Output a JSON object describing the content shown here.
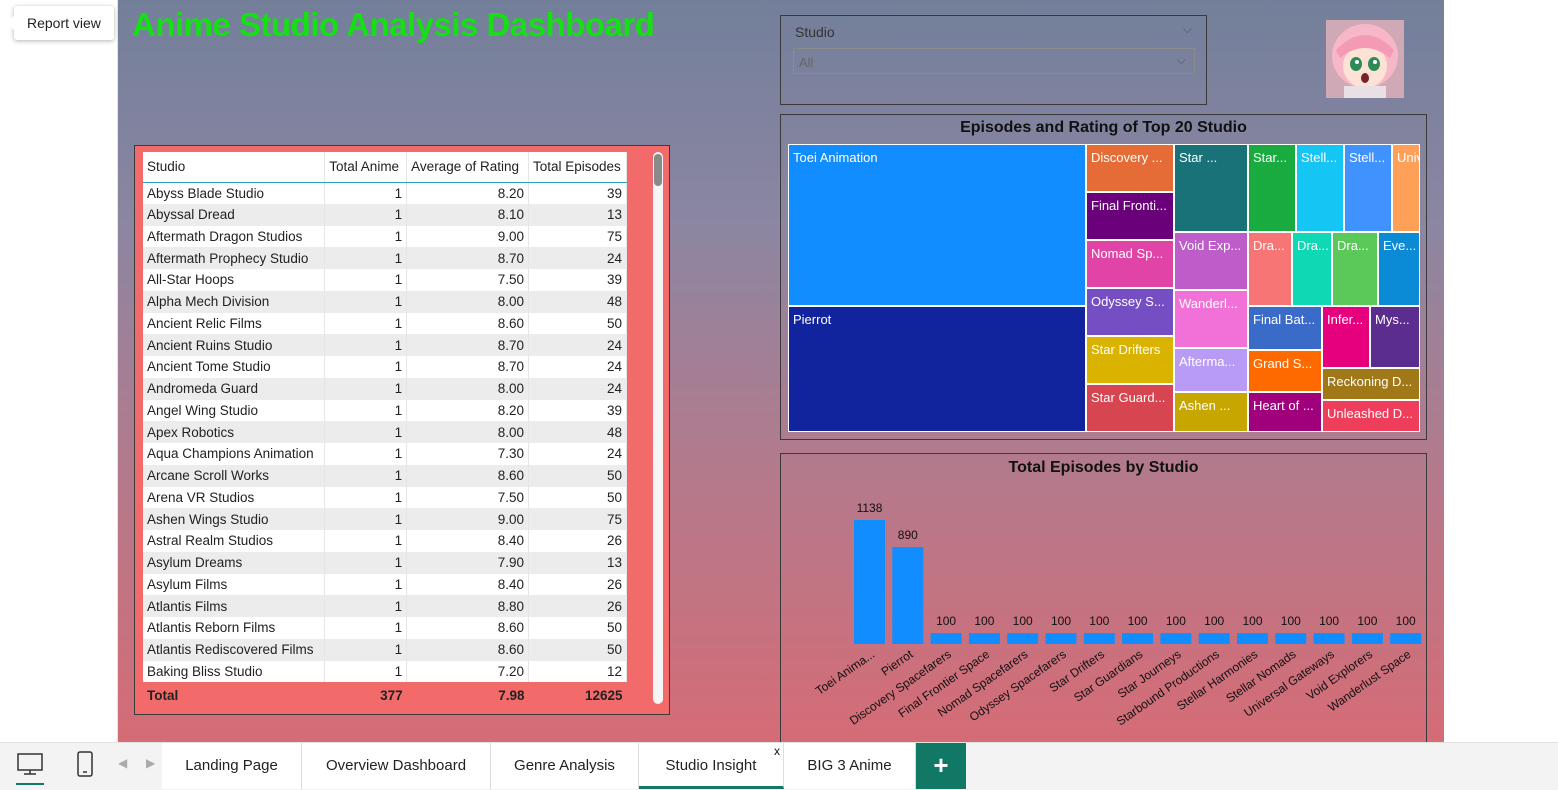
{
  "tooltip": {
    "report_view": "Report view"
  },
  "dashboard": {
    "title": "Anime Studio Analysis Dashboard"
  },
  "slicer": {
    "title": "Studio",
    "placeholder": "All"
  },
  "table": {
    "columns": [
      "Studio",
      "Total Anime",
      "Average of Rating",
      "Total Episodes"
    ],
    "rows": [
      [
        "Abyss Blade Studio",
        "1",
        "8.20",
        "39"
      ],
      [
        "Abyssal Dread",
        "1",
        "8.10",
        "13"
      ],
      [
        "Aftermath Dragon Studios",
        "1",
        "9.00",
        "75"
      ],
      [
        "Aftermath Prophecy Studio",
        "1",
        "8.70",
        "24"
      ],
      [
        "All-Star Hoops",
        "1",
        "7.50",
        "39"
      ],
      [
        "Alpha Mech Division",
        "1",
        "8.00",
        "48"
      ],
      [
        "Ancient Relic Films",
        "1",
        "8.60",
        "50"
      ],
      [
        "Ancient Ruins Studio",
        "1",
        "8.70",
        "24"
      ],
      [
        "Ancient Tome Studio",
        "1",
        "8.70",
        "24"
      ],
      [
        "Andromeda Guard",
        "1",
        "8.00",
        "24"
      ],
      [
        "Angel Wing Studio",
        "1",
        "8.20",
        "39"
      ],
      [
        "Apex Robotics",
        "1",
        "8.00",
        "48"
      ],
      [
        "Aqua Champions Animation",
        "1",
        "7.30",
        "24"
      ],
      [
        "Arcane Scroll Works",
        "1",
        "8.60",
        "50"
      ],
      [
        "Arena VR Studios",
        "1",
        "7.50",
        "50"
      ],
      [
        "Ashen Wings Studio",
        "1",
        "9.00",
        "75"
      ],
      [
        "Astral Realm Studios",
        "1",
        "8.40",
        "26"
      ],
      [
        "Asylum Dreams",
        "1",
        "7.90",
        "13"
      ],
      [
        "Asylum Films",
        "1",
        "8.40",
        "26"
      ],
      [
        "Atlantis Films",
        "1",
        "8.80",
        "26"
      ],
      [
        "Atlantis Reborn Films",
        "1",
        "8.60",
        "50"
      ],
      [
        "Atlantis Rediscovered Films",
        "1",
        "8.60",
        "50"
      ],
      [
        "Baking Bliss Studio",
        "1",
        "7.20",
        "12"
      ]
    ],
    "total": [
      "Total",
      "377",
      "7.98",
      "12625"
    ]
  },
  "treemap": {
    "title": "Episodes and Rating of Top 20 Studio",
    "tiles": [
      {
        "label": "Toei Animation",
        "color": "#118dff"
      },
      {
        "label": "Pierrot",
        "color": "#12239e"
      },
      {
        "label": "Discovery ...",
        "color": "#e66c37"
      },
      {
        "label": "Final Fronti...",
        "color": "#6b007b"
      },
      {
        "label": "Nomad Sp...",
        "color": "#e044a7"
      },
      {
        "label": "Odyssey S...",
        "color": "#744ec2"
      },
      {
        "label": "Star Drifters",
        "color": "#d9b300"
      },
      {
        "label": "Star Guard...",
        "color": "#d64550"
      },
      {
        "label": "Star ...",
        "color": "#197278"
      },
      {
        "label": "Star...",
        "color": "#1aab40"
      },
      {
        "label": "Stell...",
        "color": "#15c6f4"
      },
      {
        "label": "Stell...",
        "color": "#4092ff"
      },
      {
        "label": "Univ...",
        "color": "#ffa058"
      },
      {
        "label": "Void Exp...",
        "color": "#be5dc9"
      },
      {
        "label": "Dra...",
        "color": "#f87575"
      },
      {
        "label": "Dra...",
        "color": "#0fd8b5"
      },
      {
        "label": "Dra...",
        "color": "#5ac95a"
      },
      {
        "label": "Eve...",
        "color": "#0b8ad6"
      },
      {
        "label": "Wanderl...",
        "color": "#f271d8"
      },
      {
        "label": "Afterma...",
        "color": "#b89bf5"
      },
      {
        "label": "Ashen ...",
        "color": "#c7a600"
      },
      {
        "label": "Final Bat...",
        "color": "#3b6bc8"
      },
      {
        "label": "Grand S...",
        "color": "#ff6a00"
      },
      {
        "label": "Heart of ...",
        "color": "#a0007b"
      },
      {
        "label": "Infer...",
        "color": "#e6007e"
      },
      {
        "label": "Mys...",
        "color": "#5b2d8e"
      },
      {
        "label": "Reckoning D...",
        "color": "#a07818"
      },
      {
        "label": "Unleashed D...",
        "color": "#ef3e5b"
      }
    ]
  },
  "chart_data": {
    "type": "bar",
    "title": "Total Episodes by Studio",
    "categories": [
      "Toei Anima...",
      "Pierrot",
      "Discovery Spacefarers",
      "Final Frontier Space",
      "Nomad Spacefarers",
      "Odyssey Spacefarers",
      "Star Drifters",
      "Star Guardians",
      "Star Journeys",
      "Starbound Productions",
      "Stellar Harmonies",
      "Stellar Nomads",
      "Universal Gateways",
      "Void Explorers",
      "Wanderlust Space"
    ],
    "values": [
      1138,
      890,
      100,
      100,
      100,
      100,
      100,
      100,
      100,
      100,
      100,
      100,
      100,
      100,
      100
    ],
    "color": "#118dff"
  },
  "tabs": {
    "landing": "Landing Page",
    "overview": "Overview Dashboard",
    "genre": "Genre Analysis",
    "studio": "Studio Insight",
    "big3": "BIG 3 Anime",
    "close": "x",
    "add": "+"
  }
}
